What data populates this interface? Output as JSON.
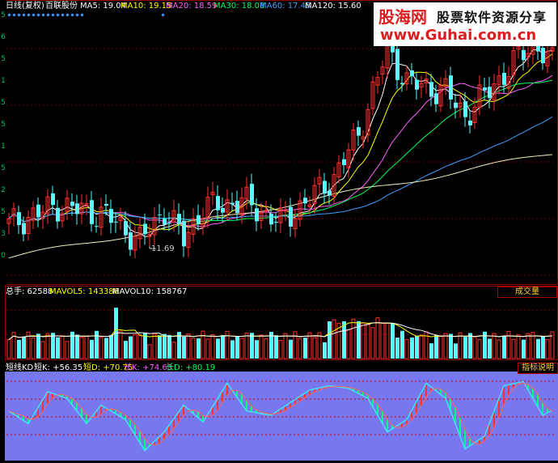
{
  "header": {
    "period": "日线(复权)",
    "stock_name": "百联股份",
    "ma": [
      {
        "label": "MA5: 19.04",
        "color": "#ffffff"
      },
      {
        "label": "MA10: 19.15",
        "color": "#ffff00"
      },
      {
        "label": "MA20: 18.59",
        "color": "#ff60ff"
      },
      {
        "label": "MA30: 18.08",
        "color": "#00ff60"
      },
      {
        "label": "MA60: 17.45",
        "color": "#40a0ff"
      },
      {
        "label": "MA120: 15.60",
        "color": "#ffffff"
      }
    ]
  },
  "logo": {
    "brand": "股海网",
    "tagline": "股票软件资源分享",
    "url": "www.Guhai.com.cn"
  },
  "left_axis_chars": [
    "5",
    "6",
    "5",
    "1",
    "5",
    "5",
    "1",
    "5",
    "2",
    "5",
    "3",
    "0"
  ],
  "low_marker": "11.69",
  "volume": {
    "total": "总手: 62588",
    "mavol5": "MAVOL5: 143386",
    "mavol10": "MAVOL10: 158767",
    "button": "成交量"
  },
  "indicator": {
    "name": "短线KD",
    "k": "短K: +56.35",
    "d": "短D: +70.75",
    "lk": "长K: +74.63",
    "ld": "长D: +80.19",
    "button": "指标说明"
  },
  "colors": {
    "up": "#ff3030",
    "down": "#54fcfc",
    "kd_bg": "#7878ee"
  },
  "chart_data": {
    "type": "candlestick",
    "low_annotation": 11.69,
    "ma_last": {
      "MA5": 19.04,
      "MA10": 19.15,
      "MA20": 18.59,
      "MA30": 18.08,
      "MA60": 17.45,
      "MA120": 15.6
    },
    "volume_last": 62588,
    "mavol5": 143386,
    "mavol10": 158767,
    "kd_last": {
      "short_k": 56.35,
      "short_d": 70.75,
      "long_k": 74.63,
      "long_d": 80.19
    }
  }
}
